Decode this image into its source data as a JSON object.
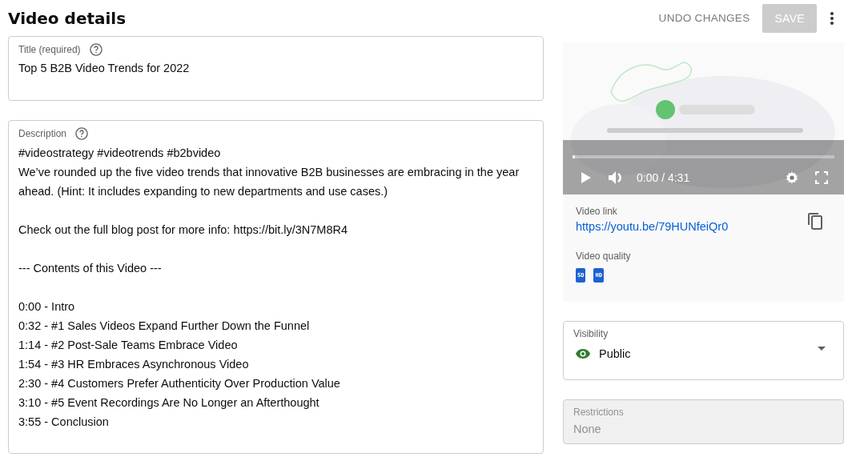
{
  "header": {
    "title": "Video details",
    "undo_button": {
      "label": "UNDO CHANGES",
      "disabled": true
    },
    "save_button": {
      "label": "SAVE",
      "disabled": true
    }
  },
  "title_field": {
    "label": "Title (required)",
    "value": "Top 5 B2B Video Trends for 2022"
  },
  "description_field": {
    "label": "Description",
    "paragraphs": [
      [
        "#videostrategy #videotrends #b2bvideo",
        "We’ve rounded up the five video trends that innovative B2B businesses are embracing in the year ahead. (Hint: It includes expanding to new departments and use cases.)"
      ],
      [
        "Check out the full blog post for more info: https://bit.ly/3N7M8R4"
      ],
      [
        "--- Contents of this Video ---"
      ],
      [
        "0:00 - Intro",
        "0:32 - #1 Sales Videos Expand Further Down the Funnel",
        "1:14 - #2 Post-Sale Teams Embrace Video",
        "1:54 - #3 HR Embraces Asynchronous Video",
        "2:30 - #4 Customers Prefer Authenticity Over Production Value",
        "3:10 - #5 Event Recordings Are No Longer an Afterthought",
        "3:55 - Conclusion"
      ]
    ]
  },
  "player": {
    "time": "0:00 / 4:31",
    "progress": {
      "level": 0.01
    }
  },
  "video_link": {
    "label": "Video link",
    "url": "https://youtu.be/79HUNfeiQr0"
  },
  "video_quality": {
    "label": "Video quality",
    "badges": [
      "SD",
      "HD"
    ]
  },
  "visibility": {
    "label": "Visibility",
    "value": "Public"
  },
  "restrictions": {
    "label": "Restrictions",
    "value": "None",
    "disabled": true
  }
}
